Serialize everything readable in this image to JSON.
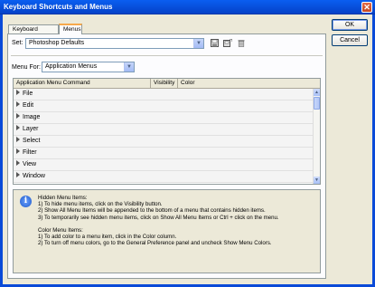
{
  "window": {
    "title": "Keyboard Shortcuts and Menus"
  },
  "tabs": [
    {
      "label": "Keyboard Shortcuts"
    },
    {
      "label": "Menus"
    }
  ],
  "set": {
    "label": "Set:",
    "value": "Photoshop Defaults"
  },
  "menu_for": {
    "label": "Menu For:",
    "value": "Application Menus"
  },
  "table": {
    "columns": [
      "Application Menu Command",
      "Visibility",
      "Color"
    ],
    "rows": [
      "File",
      "Edit",
      "Image",
      "Layer",
      "Select",
      "Filter",
      "View",
      "Window"
    ]
  },
  "info": {
    "hidden_title": "Hidden Menu Items:",
    "hidden_1": "1) To hide menu items, click on the Visibility button.",
    "hidden_2": "2) Show All Menu Items will be appended to the bottom of a menu that contains hidden items.",
    "hidden_3": "3) To temporarily see hidden menu items, click on Show All Menu Items or Ctrl + click on the menu.",
    "color_title": "Color Menu Items:",
    "color_1": "1) To add color to a menu item, click in the Color column.",
    "color_2": "2) To turn off menu colors, go to the General Preference panel and uncheck Show Menu Colors."
  },
  "buttons": {
    "ok": "OK",
    "cancel": "Cancel"
  },
  "icons": {
    "save": "save-set-icon",
    "save_as": "save-set-copy-icon",
    "delete": "delete-set-icon",
    "info": "info-icon"
  }
}
